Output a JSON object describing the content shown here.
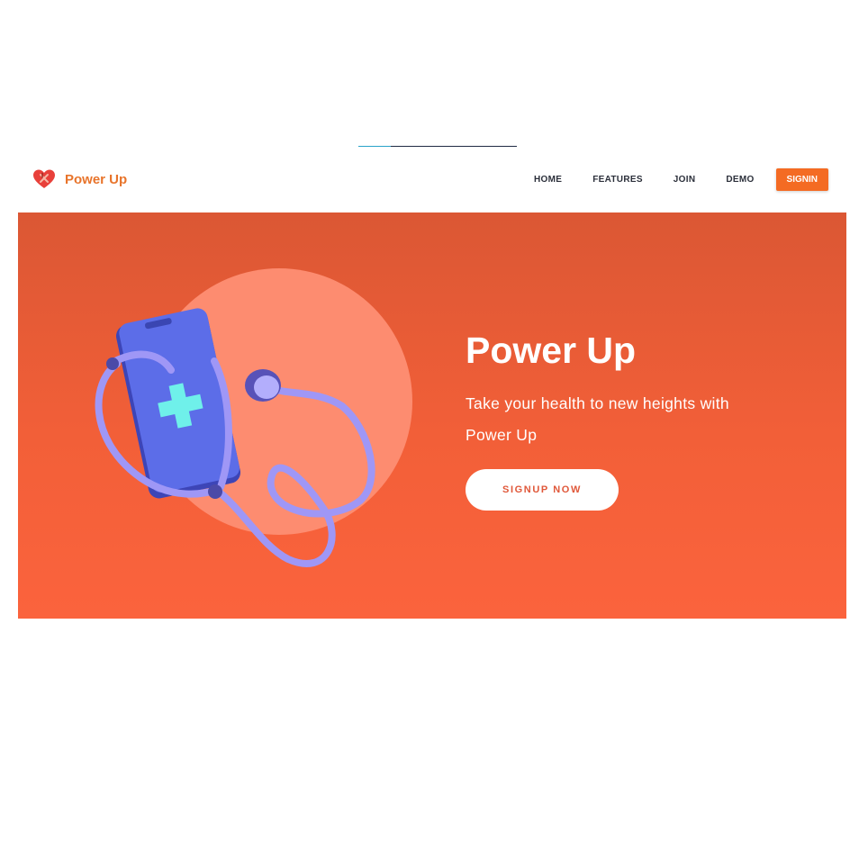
{
  "brand": {
    "name": "Power Up",
    "logo_icon": "heart-icon",
    "color": "#e8742b"
  },
  "nav": {
    "items": [
      {
        "label": "HOME"
      },
      {
        "label": "FEATURES"
      },
      {
        "label": "JOIN"
      },
      {
        "label": "DEMO"
      }
    ],
    "signin_label": "SIGNIN"
  },
  "hero": {
    "title": "Power Up",
    "subtitle": "Take your health to new heights with Power Up",
    "cta_label": "SIGNUP NOW",
    "illustration_icon": "phone-stethoscope-icon",
    "background_color": "#f25f38",
    "accent_color": "#f46b23"
  }
}
